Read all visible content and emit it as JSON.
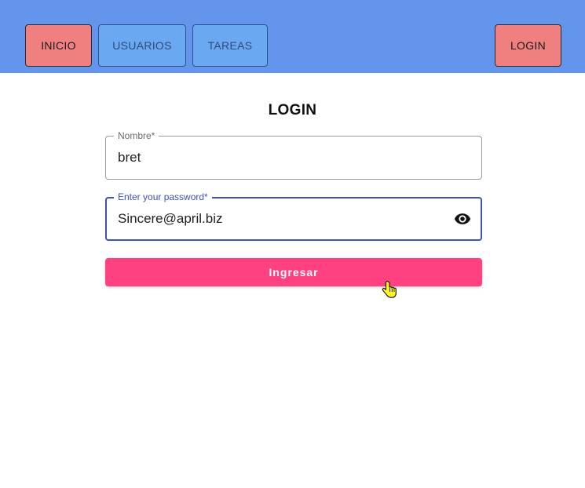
{
  "nav": {
    "inicio_label": "INICIO",
    "usuarios_label": "USUARIOS",
    "tareas_label": "TAREAS",
    "login_label": "LOGIN"
  },
  "form": {
    "title": "LOGIN",
    "name_label": "Nombre*",
    "name_value": "bret",
    "password_label": "Enter your password*",
    "password_value": "Sincere@april.biz",
    "submit_label": "Ingresar"
  },
  "colors": {
    "topbar": "#6495ed",
    "nav_active": "#f08080",
    "nav_inactive": "#6aa8f2",
    "focus_border": "#3f51b5",
    "submit": "#ff4081"
  },
  "icons": {
    "visibility": "eye-icon",
    "pointer": "hand-cursor-icon"
  }
}
